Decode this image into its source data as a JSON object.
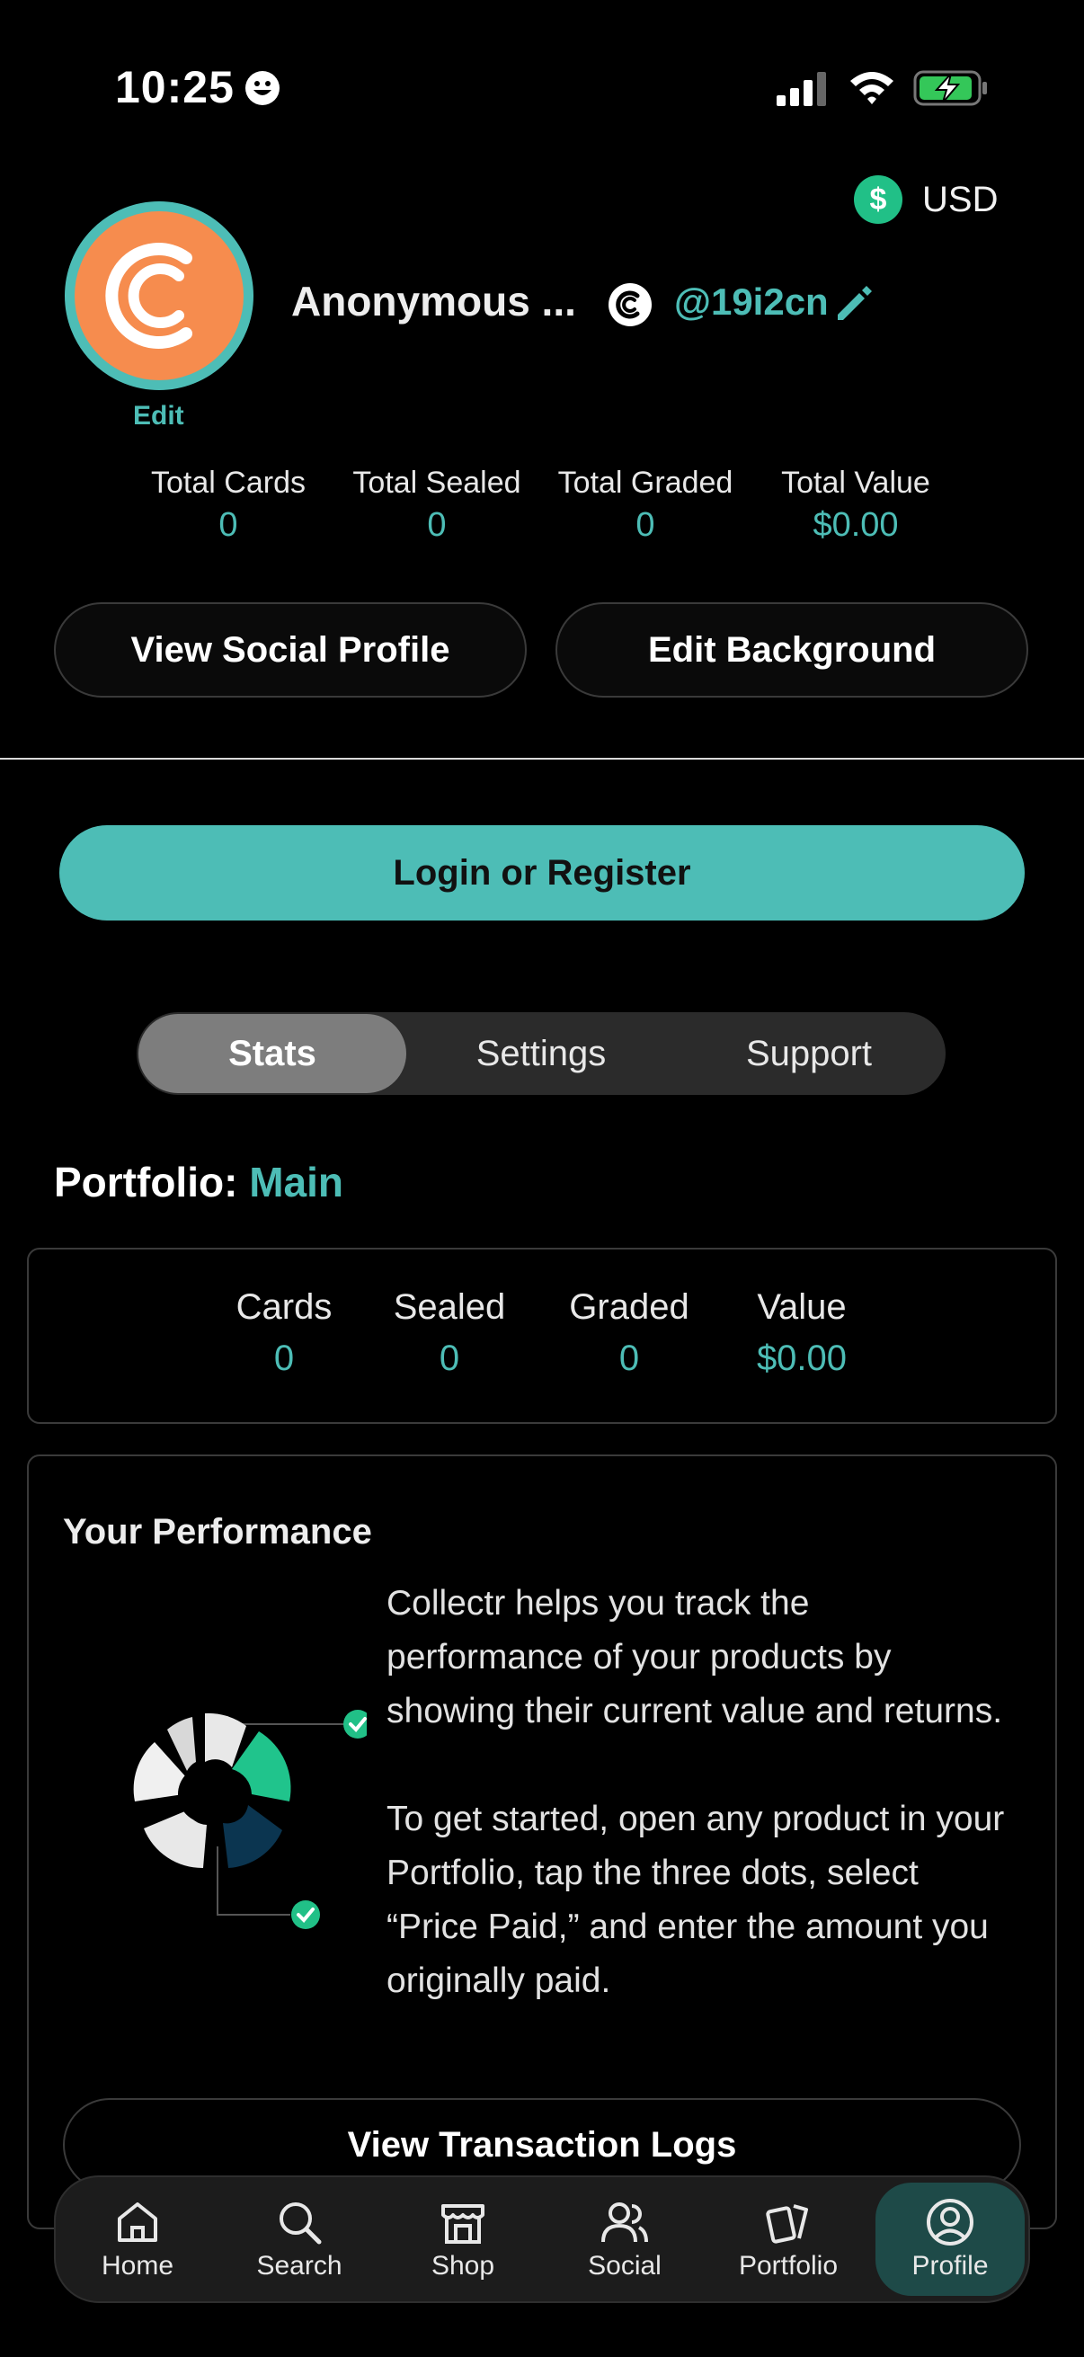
{
  "status_bar": {
    "time": "10:25"
  },
  "currency": {
    "code": "USD",
    "symbol": "$"
  },
  "profile": {
    "avatar_edit_label": "Edit",
    "name": "Anonymous ...",
    "handle": "@19i2cn"
  },
  "totals": [
    {
      "label": "Total Cards",
      "value": "0"
    },
    {
      "label": "Total Sealed",
      "value": "0"
    },
    {
      "label": "Total Graded",
      "value": "0"
    },
    {
      "label": "Total Value",
      "value": "$0.00"
    }
  ],
  "buttons": {
    "view_social_profile": "View Social Profile",
    "edit_background": "Edit Background",
    "login_register": "Login or Register",
    "view_transaction_logs": "View Transaction Logs"
  },
  "tabs": [
    {
      "label": "Stats",
      "active": true
    },
    {
      "label": "Settings",
      "active": false
    },
    {
      "label": "Support",
      "active": false
    }
  ],
  "portfolio": {
    "prefix": "Portfolio:",
    "name": "Main",
    "stats": [
      {
        "label": "Cards",
        "value": "0"
      },
      {
        "label": "Sealed",
        "value": "0"
      },
      {
        "label": "Graded",
        "value": "0"
      },
      {
        "label": "Value",
        "value": "$0.00"
      }
    ]
  },
  "performance": {
    "title": "Your Performance",
    "paragraph1": "Collectr helps you track the performance of your products by showing their current value and returns.",
    "paragraph2": "To get started, open any product in your Portfolio, tap the three dots, select “Price Paid,” and enter the amount you originally paid."
  },
  "nav": [
    {
      "label": "Home",
      "icon": "home-icon"
    },
    {
      "label": "Search",
      "icon": "search-icon"
    },
    {
      "label": "Shop",
      "icon": "shop-icon"
    },
    {
      "label": "Social",
      "icon": "social-icon"
    },
    {
      "label": "Portfolio",
      "icon": "portfolio-icon"
    },
    {
      "label": "Profile",
      "icon": "profile-icon",
      "active": true
    }
  ],
  "colors": {
    "accent": "#4dbdb6",
    "avatar_bg": "#f68c4e",
    "coin": "#21c087",
    "background": "#000000"
  }
}
